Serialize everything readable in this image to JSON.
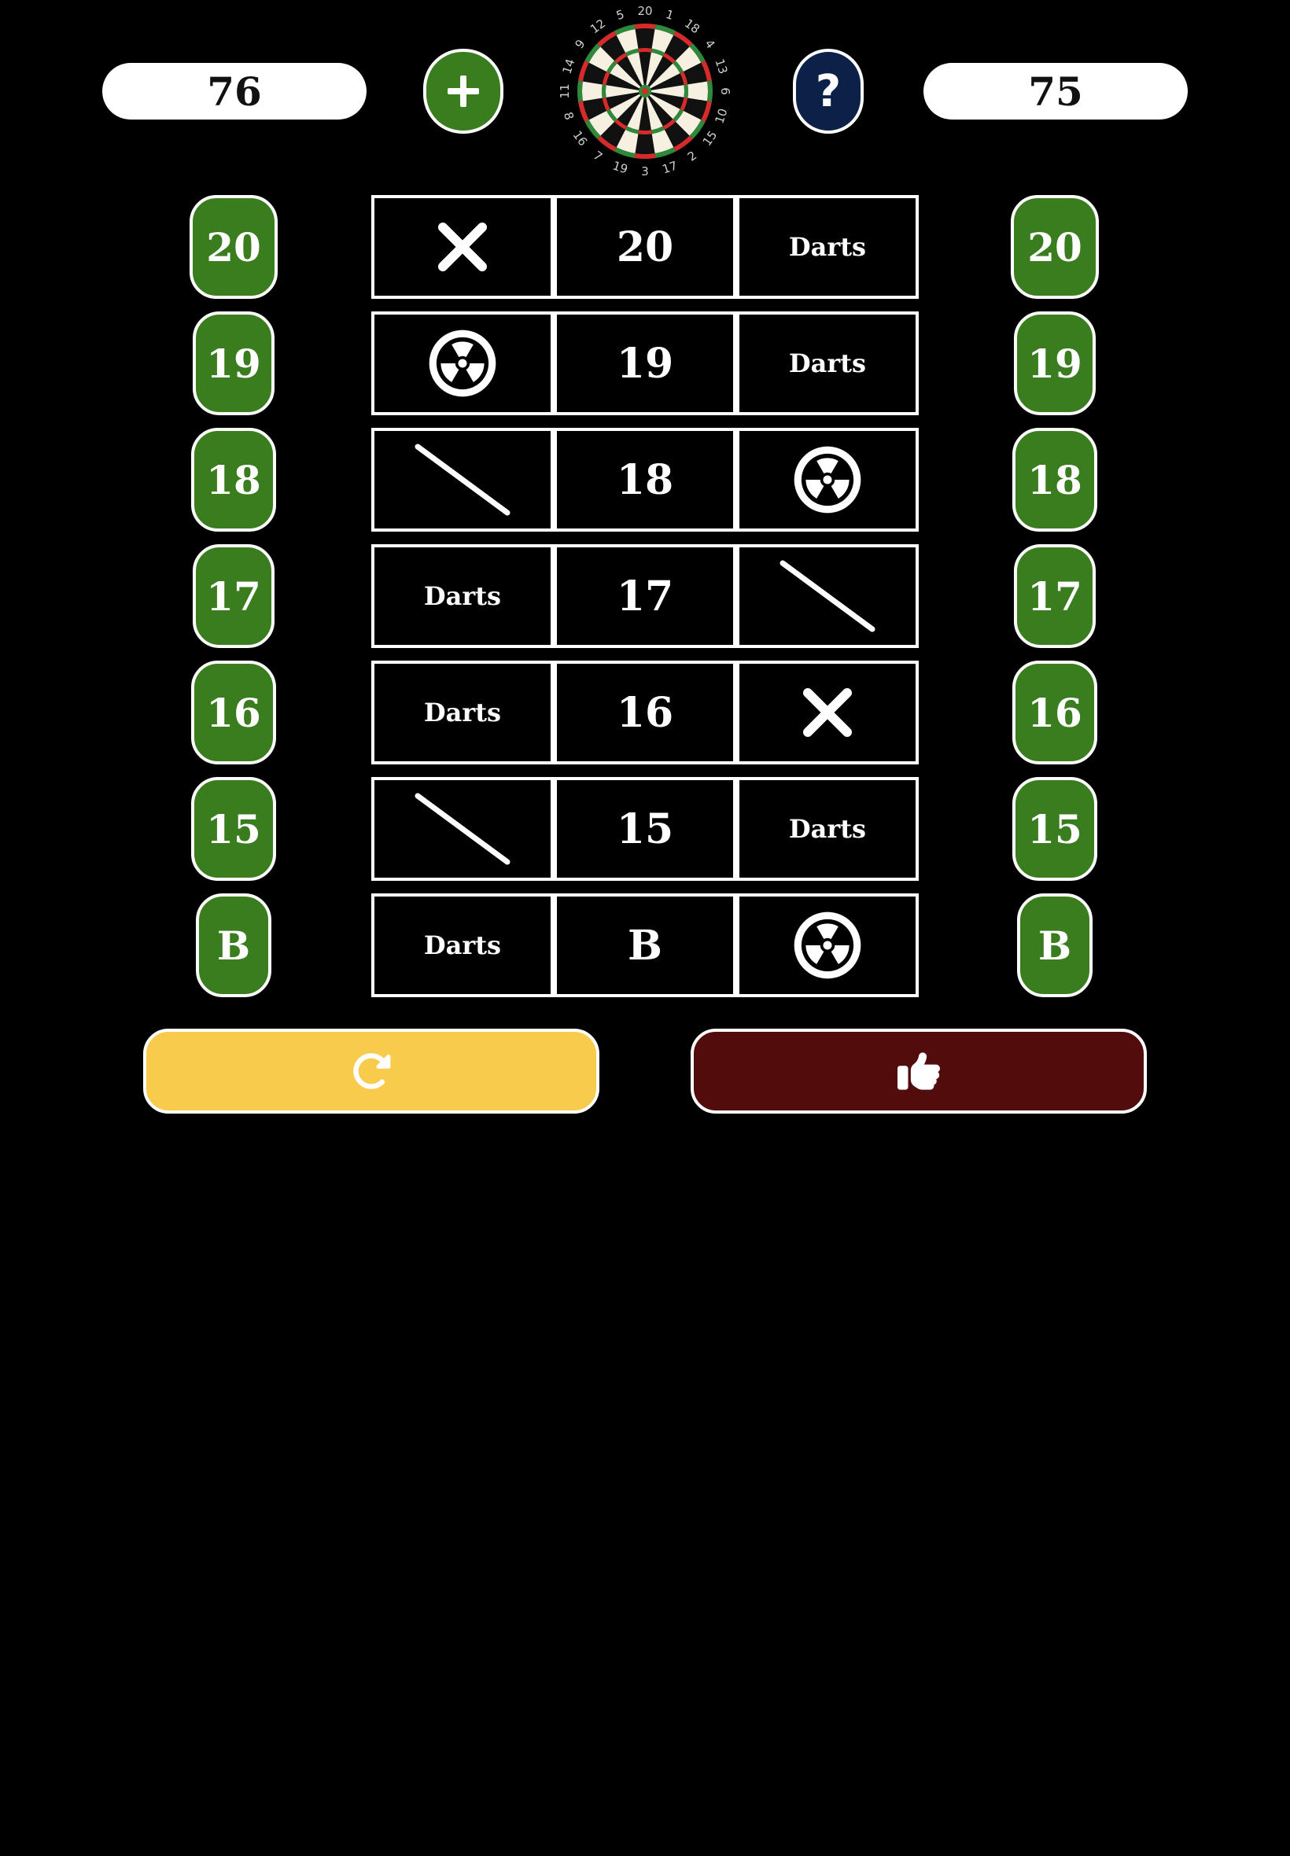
{
  "scores": {
    "left": "76",
    "right": "75"
  },
  "help_label": "?",
  "dartboard": {
    "numbers": [
      "20",
      "1",
      "18",
      "4",
      "13",
      "6",
      "10",
      "15",
      "2",
      "17",
      "3",
      "19",
      "7",
      "16",
      "8",
      "11",
      "14",
      "9",
      "12",
      "5"
    ],
    "colors": {
      "black": "#111111",
      "cream": "#f5f0e0",
      "red": "#d52b2b",
      "green": "#2e8a3a"
    }
  },
  "rows": [
    {
      "label": "20",
      "left_mark": "cross",
      "right_mark": "darts"
    },
    {
      "label": "19",
      "left_mark": "nuclear",
      "right_mark": "darts"
    },
    {
      "label": "18",
      "left_mark": "slash",
      "right_mark": "nuclear"
    },
    {
      "label": "17",
      "left_mark": "darts",
      "right_mark": "slash"
    },
    {
      "label": "16",
      "left_mark": "darts",
      "right_mark": "cross"
    },
    {
      "label": "15",
      "left_mark": "slash",
      "right_mark": "darts"
    },
    {
      "label": "B",
      "left_mark": "darts",
      "right_mark": "nuclear"
    }
  ],
  "mark_text": {
    "darts": "Darts"
  },
  "icons": {
    "add": "plus-icon",
    "help": "question-icon",
    "refresh": "refresh-icon",
    "confirm": "thumbs-up-icon"
  },
  "colors": {
    "button_green": "#3a7d1f",
    "help_navy": "#0b2147",
    "refresh_yellow": "#f9cb4c",
    "confirm_maroon": "#520c0c"
  }
}
